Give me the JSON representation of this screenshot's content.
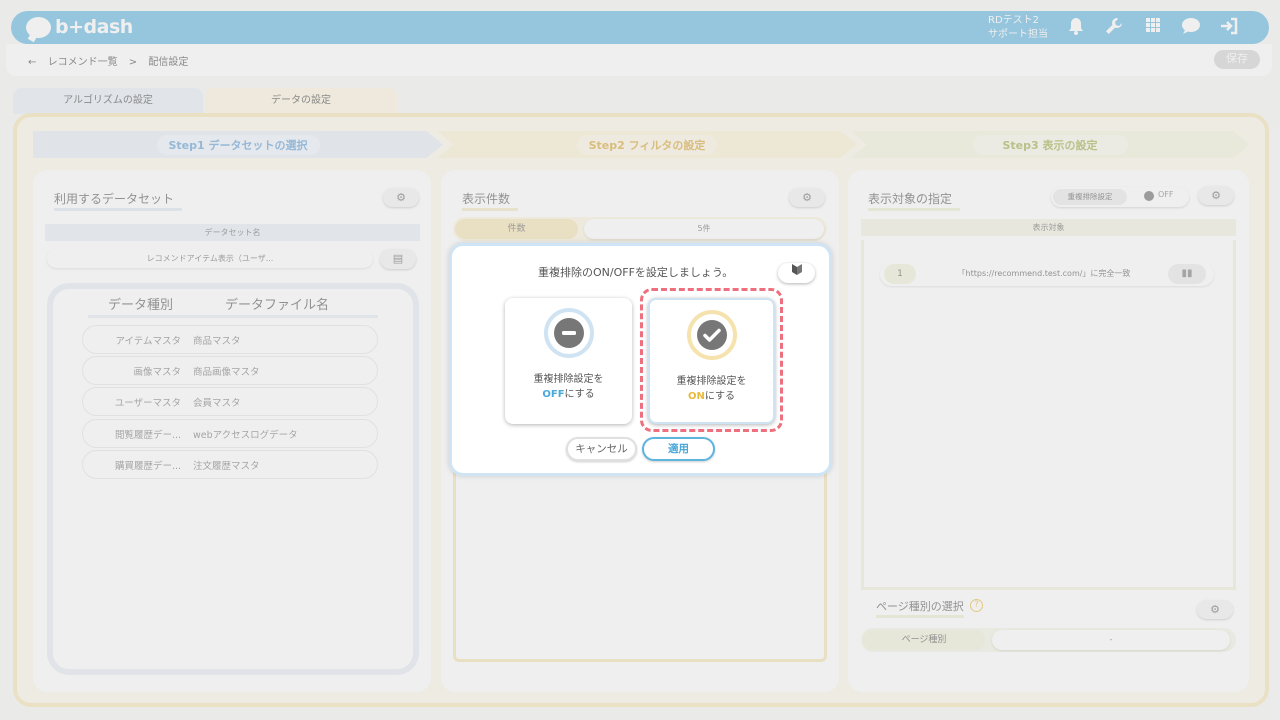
{
  "header": {
    "logo_text": "b+dash",
    "user_line1": "RDテスト2",
    "user_line2": "サポート担当",
    "icons": [
      "bell-icon",
      "wrench-icon",
      "grid-icon",
      "chat-icon",
      "logout-icon"
    ]
  },
  "topbar": {
    "back_symbol": "←",
    "crumb1": "レコメンド一覧",
    "separator": ">",
    "crumb2": "配信設定",
    "save_label": "保存"
  },
  "tabs": [
    {
      "label": "アルゴリズムの設定"
    },
    {
      "label": "データの設定"
    }
  ],
  "steps": [
    {
      "label": "Step1 データセットの選択"
    },
    {
      "label": "Step2 フィルタの設定"
    },
    {
      "label": "Step3 表示の設定"
    }
  ],
  "dataset_panel": {
    "title": "利用するデータセット",
    "dataset_name_header": "データセット名",
    "dataset_name_value": "レコメンドアイテム表示（ユーザ...",
    "col_type": "データ種別",
    "col_file": "データファイル名",
    "rows": [
      {
        "type": "アイテムマスタ",
        "file": "商品マスタ"
      },
      {
        "type": "画像マスタ",
        "file": "商品画像マスタ"
      },
      {
        "type": "ユーザーマスタ",
        "file": "会員マスタ"
      },
      {
        "type": "閲覧履歴デー...",
        "file": "webアクセスログデータ"
      },
      {
        "type": "購買履歴デー...",
        "file": "注文履歴マスタ"
      }
    ]
  },
  "count_panel": {
    "title": "表示件数",
    "count_label": "件数",
    "count_value": "5件"
  },
  "target_panel": {
    "title": "表示対象の指定",
    "dedupe_label": "重複排除設定",
    "dedupe_state": "OFF",
    "target_header": "表示対象",
    "target_index": "1",
    "target_value": "「https://recommend.test.com/」に完全一致",
    "page_type_title": "ページ種別の選択",
    "page_type_label": "ページ種別",
    "page_type_value": "-"
  },
  "modal": {
    "question": "重複排除のON/OFFを設定しましょう。",
    "off_line1": "重複排除設定を",
    "off_keyword": "OFF",
    "off_suffix": "にする",
    "on_line1": "重複排除設定を",
    "on_keyword": "ON",
    "on_suffix": "にする",
    "cancel_label": "キャンセル",
    "apply_label": "適用"
  },
  "colors": {
    "brand": "#5cb4df",
    "off_accent": "#4aa8da",
    "on_accent": "#e9b93a",
    "highlight_dash": "#ee6f7d"
  }
}
